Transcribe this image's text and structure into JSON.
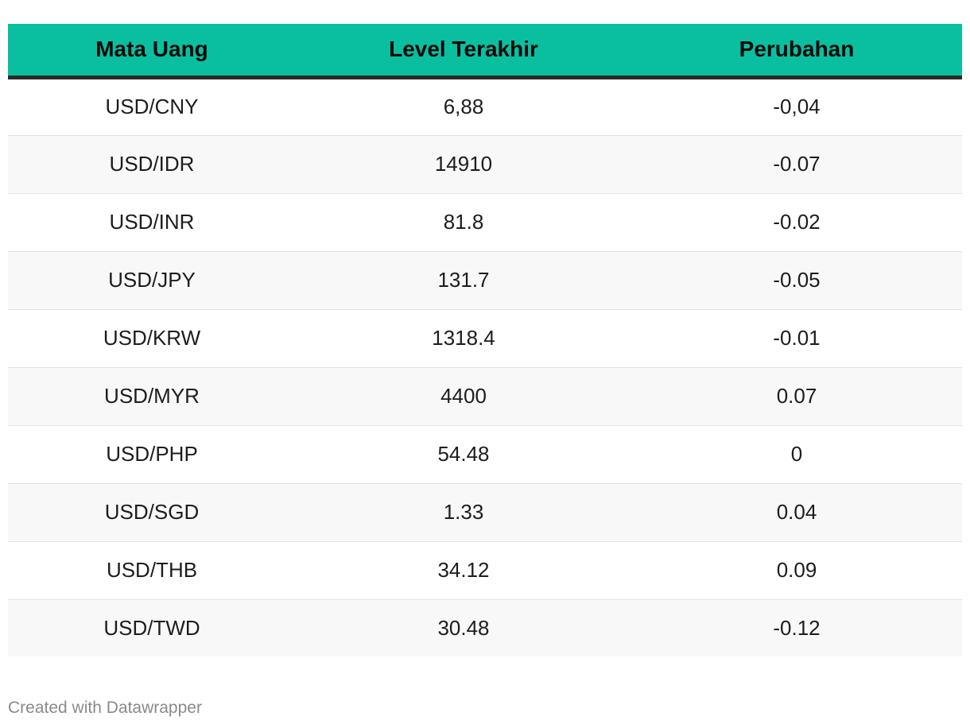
{
  "chart_data": {
    "type": "table",
    "columns": [
      "Mata Uang",
      "Level Terakhir",
      "Perubahan"
    ],
    "rows": [
      [
        "USD/CNY",
        "6,88",
        "-0,04"
      ],
      [
        "USD/IDR",
        "14910",
        "-0.07"
      ],
      [
        "USD/INR",
        "81.8",
        "-0.02"
      ],
      [
        "USD/JPY",
        "131.7",
        "-0.05"
      ],
      [
        "USD/KRW",
        "1318.4",
        "-0.01"
      ],
      [
        "USD/MYR",
        "4400",
        "0.07"
      ],
      [
        "USD/PHP",
        "54.48",
        "0"
      ],
      [
        "USD/SGD",
        "1.33",
        "0.04"
      ],
      [
        "USD/THB",
        "34.12",
        "0.09"
      ],
      [
        "USD/TWD",
        "30.48",
        "-0.12"
      ]
    ],
    "header_color": "#0abfa0",
    "stripe_color": "#f8f8f8"
  },
  "footer": {
    "credit": "Created with Datawrapper"
  }
}
